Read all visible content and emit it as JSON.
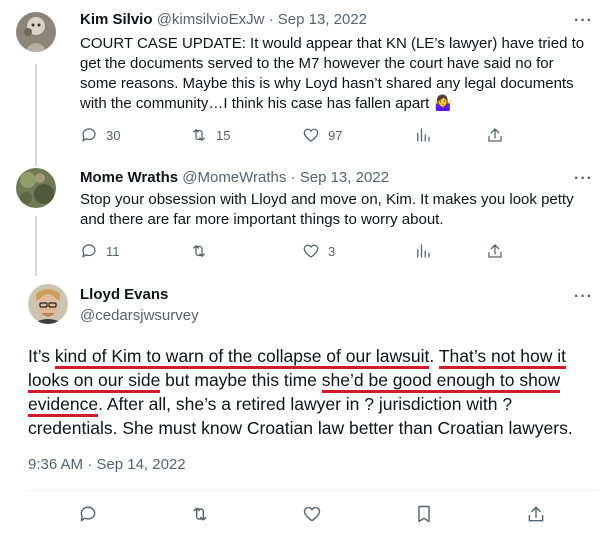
{
  "tweets": [
    {
      "name": "Kim Silvio",
      "handle": "@kimsilvioExJw",
      "dot": "·",
      "date": "Sep 13, 2022",
      "text": "COURT CASE UPDATE: It would appear that KN (LE’s lawyer) have tried to get the documents served to the M7 however the court have said no for some reasons. Maybe this is why Loyd hasn’t shared any legal documents with the community…I think his case has fallen apart 🤷‍♀️",
      "replies": "30",
      "retweets": "15",
      "likes": "97"
    },
    {
      "name": "Mome Wraths",
      "handle": "@MomeWraths",
      "dot": "·",
      "date": "Sep 13, 2022",
      "text": "Stop your obsession with Lloyd and move on, Kim. It makes you look petty and there are far more important things to worry about.",
      "replies": "11",
      "retweets": "",
      "likes": "3"
    }
  ],
  "main_tweet": {
    "name": "Lloyd Evans",
    "handle": "@cedarsjwsurvey",
    "text_parts": [
      "It’s ",
      "kind of Kim to warn of the collapse of our lawsuit",
      ". ",
      "That’s not how it looks on our side",
      " but maybe this time ",
      "she’d be good enough to show evidence",
      ". After all, she’s a retired lawyer in ? jurisdiction with ? credentials. She must know Croatian law better than Croatian lawyers."
    ],
    "timestamp": "9:36 AM · Sep 14, 2022"
  },
  "more_label": "···",
  "icons": {
    "reply": "reply-icon",
    "retweet": "retweet-icon",
    "like": "heart-icon",
    "views": "analytics-icon",
    "share": "share-icon",
    "bookmark": "bookmark-icon"
  },
  "colors": {
    "text": "#0f1419",
    "secondary": "#536471",
    "underline": "#d11a2a",
    "thread_line": "#cfd9de"
  }
}
